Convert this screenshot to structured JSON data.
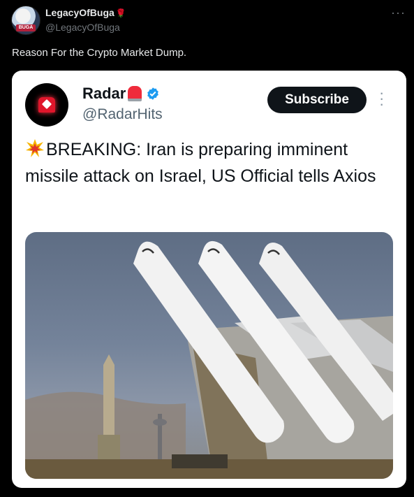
{
  "tweet": {
    "author_name": "LegacyOfBuga",
    "author_handle": "@LegacyOfBuga",
    "avatar_badge": "BUGA",
    "more": "···",
    "text": "Reason For the Crypto Market Dump."
  },
  "quoted": {
    "name": "Radar",
    "handle": "@RadarHits",
    "subscribe_label": "Subscribe",
    "body": "BREAKING: Iran is preparing imminent missile attack on Israel, US Official tells Axios",
    "image_icon": "missiles-photo"
  },
  "colors": {
    "background": "#000000",
    "card": "#ffffff",
    "verified": "#1d9bf0",
    "subscribe_bg": "#0f1419"
  }
}
